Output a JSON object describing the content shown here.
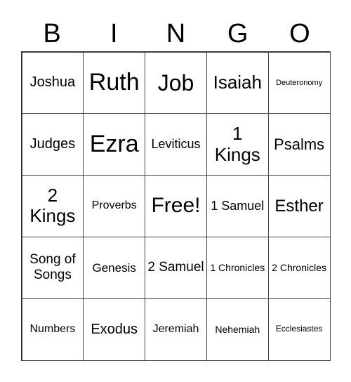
{
  "header": [
    "B",
    "I",
    "N",
    "G",
    "O"
  ],
  "cells": [
    {
      "text": "Joshua",
      "size": 20
    },
    {
      "text": "Ruth",
      "size": 34
    },
    {
      "text": "Job",
      "size": 32
    },
    {
      "text": "Isaiah",
      "size": 26
    },
    {
      "text": "Deuteronomy",
      "size": 11
    },
    {
      "text": "Judges",
      "size": 20
    },
    {
      "text": "Ezra",
      "size": 34
    },
    {
      "text": "Leviticus",
      "size": 18
    },
    {
      "text": "1 Kings",
      "size": 26
    },
    {
      "text": "Psalms",
      "size": 22
    },
    {
      "text": "2 Kings",
      "size": 26
    },
    {
      "text": "Proverbs",
      "size": 16
    },
    {
      "text": "Free!",
      "size": 30
    },
    {
      "text": "1 Samuel",
      "size": 18
    },
    {
      "text": "Esther",
      "size": 24
    },
    {
      "text": "Song of Songs",
      "size": 19
    },
    {
      "text": "Genesis",
      "size": 17
    },
    {
      "text": "2 Samuel",
      "size": 19
    },
    {
      "text": "1 Chronicles",
      "size": 14
    },
    {
      "text": "2 Chronicles",
      "size": 14
    },
    {
      "text": "Numbers",
      "size": 16
    },
    {
      "text": "Exodus",
      "size": 20
    },
    {
      "text": "Jeremiah",
      "size": 16
    },
    {
      "text": "Nehemiah",
      "size": 14
    },
    {
      "text": "Ecclesiastes",
      "size": 12
    }
  ]
}
